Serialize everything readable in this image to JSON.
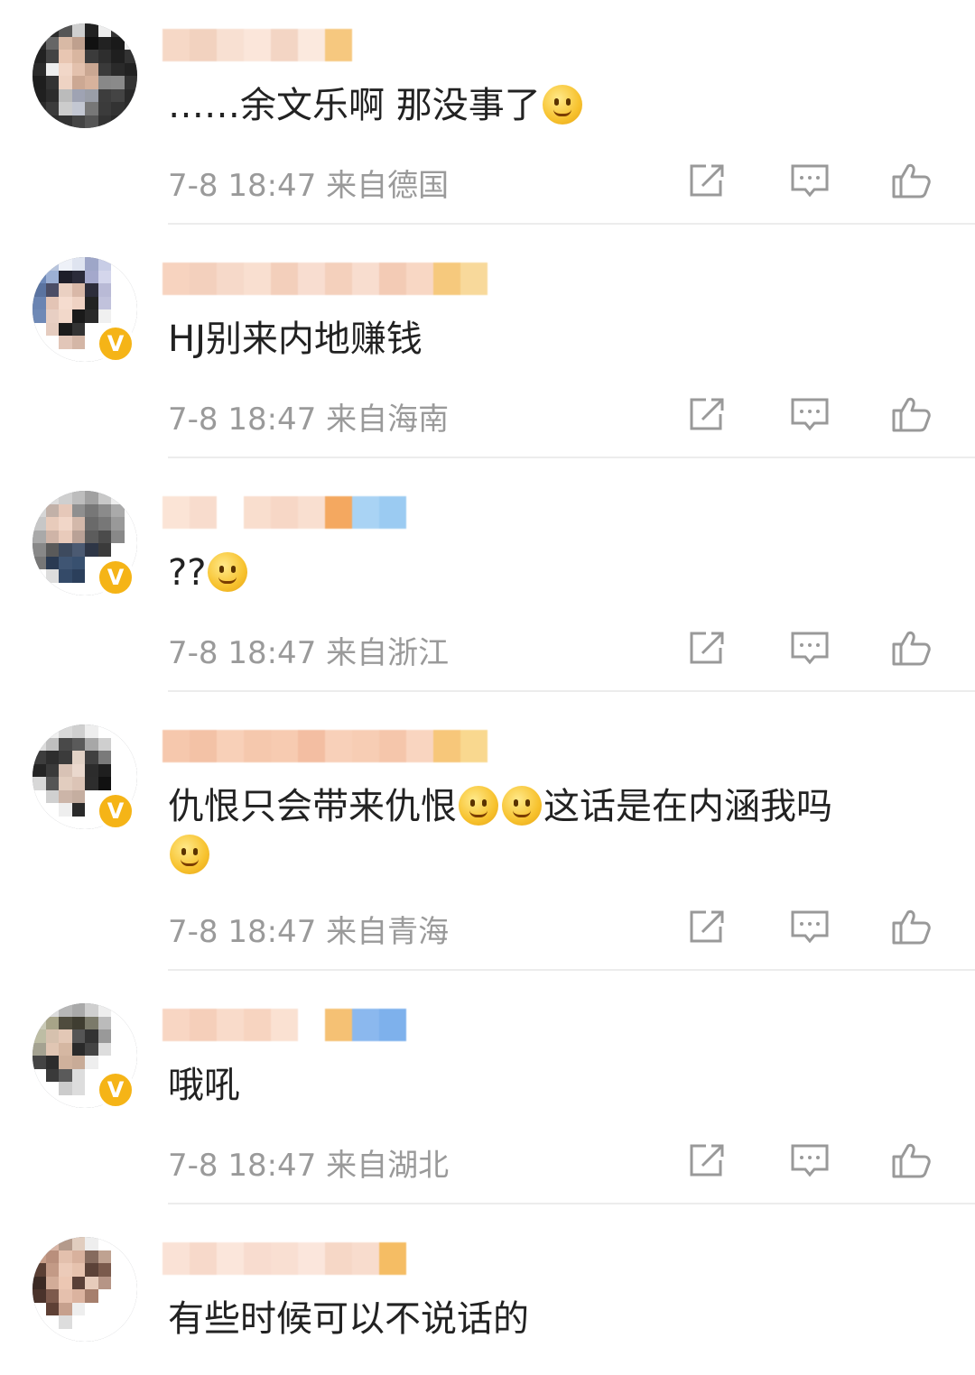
{
  "comments": [
    {
      "text": "……余文乐啊 那没事了",
      "emojis": [
        "laugh-cry"
      ],
      "time": "7-8 18:47",
      "location": "来自德国",
      "verified": false
    },
    {
      "text": "HJ别来内地赚钱",
      "emojis": [],
      "time": "7-8 18:47",
      "location": "来自海南",
      "verified": true
    },
    {
      "text": "??",
      "emojis": [
        "question-face"
      ],
      "time": "7-8 18:47",
      "location": "来自浙江",
      "verified": true
    },
    {
      "text": "仇恨只会带来仇恨",
      "text_after": "这话是在内涵我吗",
      "emojis": [
        "thinking",
        "thinking",
        "smile"
      ],
      "time": "7-8 18:47",
      "location": "来自青海",
      "verified": true
    },
    {
      "text": "哦吼",
      "emojis": [],
      "time": "7-8 18:47",
      "location": "来自湖北",
      "verified": true
    },
    {
      "text": "有些时候可以不说话的",
      "emojis": [],
      "time": "",
      "location": "",
      "verified": false
    }
  ],
  "colors": {
    "verified_badge": "#f5b417",
    "meta_text": "#9a9a9a",
    "icon": "#999999"
  },
  "icons": {
    "share": "share-icon",
    "reply": "comment-icon",
    "like": "thumbs-up-icon"
  }
}
